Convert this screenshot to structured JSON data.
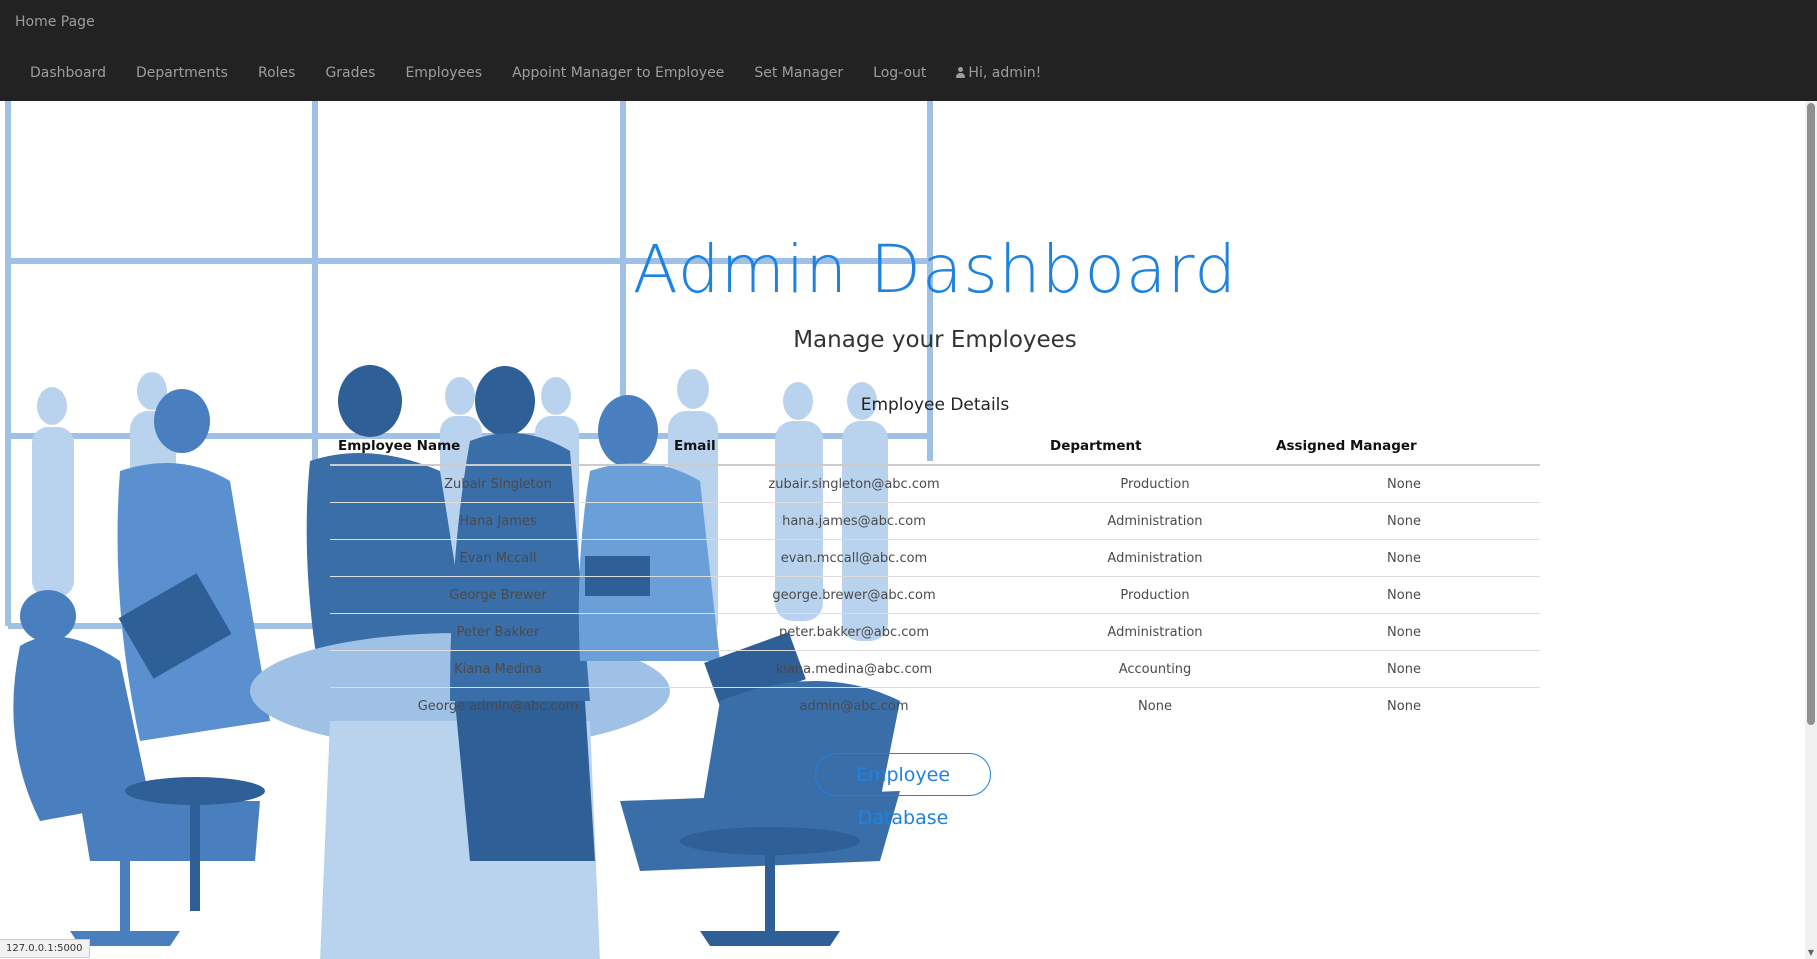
{
  "navbar": {
    "brand": "Home Page",
    "links": [
      "Dashboard",
      "Departments",
      "Roles",
      "Grades",
      "Employees",
      "Appoint Manager to Employee",
      "Set Manager",
      "Log-out"
    ],
    "user_greeting": "Hi, admin!",
    "user_icon": "user-icon"
  },
  "main": {
    "title": "Admin Dashboard",
    "subtitle": "Manage your Employees",
    "table_caption": "Employee Details",
    "table": {
      "headers": [
        "Employee Name",
        "Email",
        "Department",
        "Assigned Manager"
      ],
      "rows": [
        [
          "Zubair Singleton",
          "zubair.singleton@abc.com",
          "Production",
          "None"
        ],
        [
          "Hana James",
          "hana.james@abc.com",
          "Administration",
          "None"
        ],
        [
          "Evan Mccall",
          "evan.mccall@abc.com",
          "Administration",
          "None"
        ],
        [
          "George Brewer",
          "george.brewer@abc.com",
          "Production",
          "None"
        ],
        [
          "Peter Bakker",
          "peter.bakker@abc.com",
          "Administration",
          "None"
        ],
        [
          "Kiana Medina",
          "kiana.medina@abc.com",
          "Accounting",
          "None"
        ],
        [
          "George admin@abc.com",
          "admin@abc.com",
          "None",
          "None"
        ]
      ]
    },
    "button_label": "Employee Database"
  },
  "status_bar": {
    "url": "127.0.0.1:5000"
  },
  "colors": {
    "navbar_bg": "#222222",
    "nav_text": "#9d9d9d",
    "accent": "#1e82e1",
    "illustration_dark": "#2e5f97",
    "illustration_mid": "#4a7fbf",
    "illustration_light": "#9fc1e6"
  }
}
